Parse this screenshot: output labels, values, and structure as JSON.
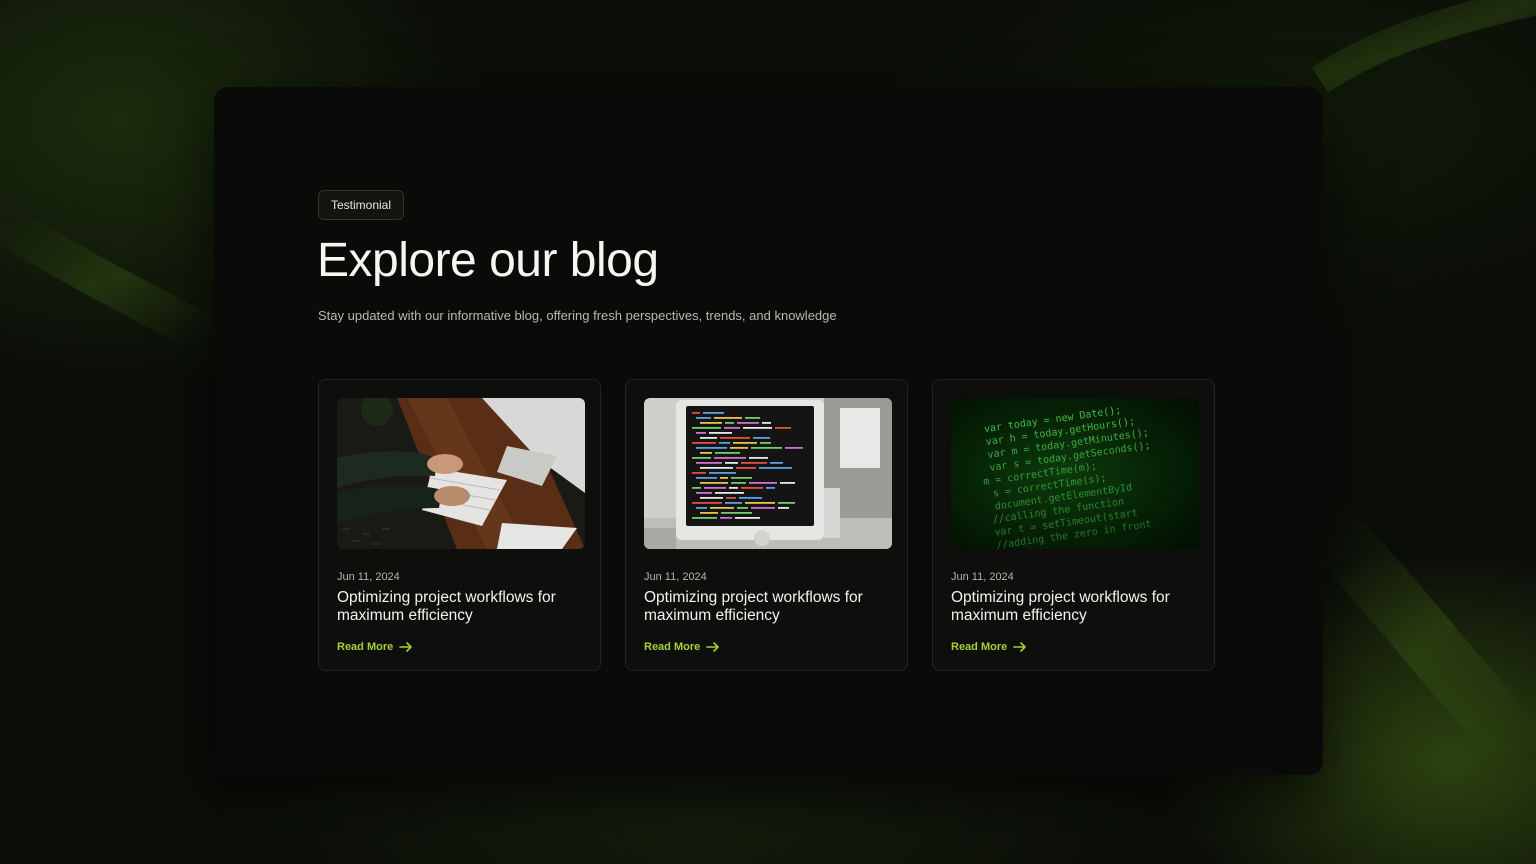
{
  "section": {
    "eyebrow": "Testimonial",
    "title": "Explore our blog",
    "subtitle": "Stay updated with our informative blog, offering fresh perspectives, trends, and knowledge"
  },
  "posts": [
    {
      "date": "Jun 11, 2024",
      "title": "Optimizing project workflows for maximum efficiency",
      "link_label": "Read More",
      "image": "hands-typing-on-keyboard-photo"
    },
    {
      "date": "Jun 11, 2024",
      "title": "Optimizing project workflows for maximum efficiency",
      "link_label": "Read More",
      "image": "monitor-with-code-photo"
    },
    {
      "date": "Jun 11, 2024",
      "title": "Optimizing project workflows for maximum efficiency",
      "link_label": "Read More",
      "image": "green-code-screen-photo"
    }
  ],
  "code_lines": [
    "var today = new Date();",
    "var h = today.getHours();",
    "var m = today.getMinutes();",
    "var s = today.getSeconds();",
    "m = correctTime(m);",
    "s = correctTime(s);",
    "document.getElementById",
    "//calling the function",
    "var t = setTimeout(start",
    "//adding the zero in front"
  ],
  "colors": {
    "accent": "#a4d13a",
    "background": "#0b0d09",
    "panel": "#0a0a09",
    "card": "#0e0e0c"
  }
}
